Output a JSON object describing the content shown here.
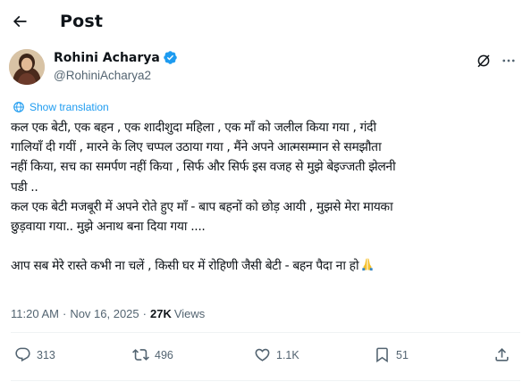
{
  "header": {
    "title": "Post"
  },
  "author": {
    "display_name": "Rohini Acharya",
    "handle": "@RohiniAcharya2",
    "verified": true
  },
  "translation": {
    "label": "Show translation"
  },
  "tweet": {
    "lines": [
      "कल एक बेटी, एक बहन , एक शादीशुदा महिला , एक माँ को जलील किया गया , गंदी",
      "गालियाँ दी गयीं , मारने के लिए चप्पल उठाया गया , मैंने  अपने आत्मसम्मान से समझौता",
      "नहीं किया, सच का समर्पण नहीं किया , सिर्फ और सिर्फ इस वजह से मुझे बेइज्जती झेलनी",
      "पडी ..",
      "कल एक बेटी मजबूरी में अपने रोते हुए माँ - बाप बहनों को छोड़  आयी , मुझसे मेरा मायका",
      "छुड़वाया गया.. मुझे अनाथ बना दिया गया ....",
      "",
      "आप सब मेरे रास्ते कभी ना चलें , किसी घर में रोहिणी जैसी बेटी - बहन  पैदा ना  हो"
    ],
    "emoji": "folded-hands"
  },
  "meta": {
    "time": "11:20 AM",
    "separator": "·",
    "date": "Nov 16, 2025",
    "views_count": "27K",
    "views_label": "Views"
  },
  "actions": {
    "replies": "313",
    "reposts": "496",
    "likes": "1.1K",
    "bookmarks": "51"
  },
  "colors": {
    "accent": "#1d9bf0",
    "text": "#0f1419",
    "secondary": "#536471",
    "divider": "#eff3f4"
  }
}
